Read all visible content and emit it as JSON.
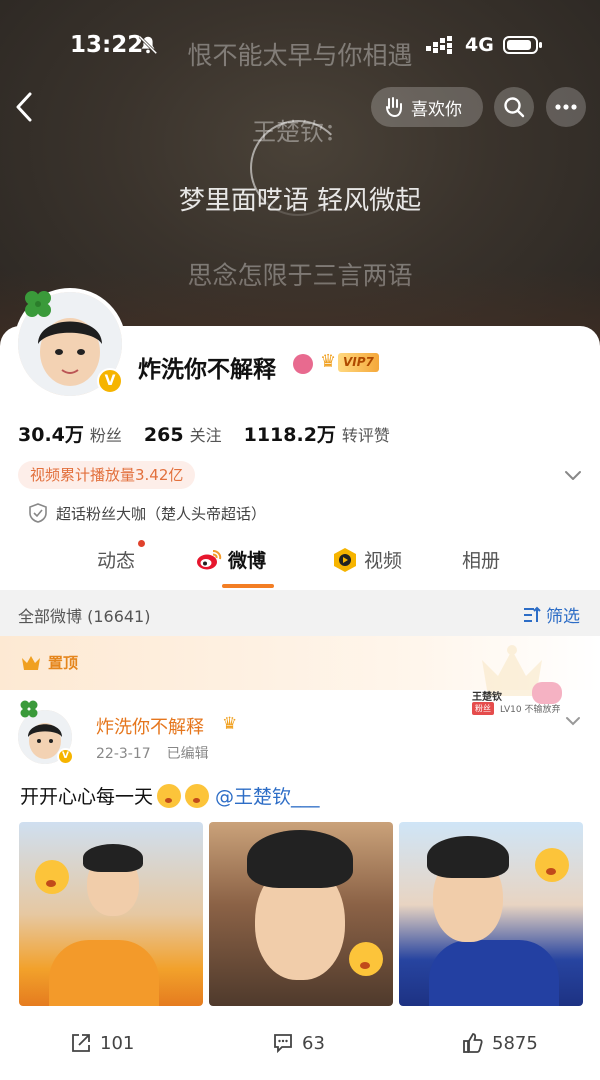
{
  "status_bar": {
    "time": "13:22",
    "network": "4G"
  },
  "header": {
    "lyrics": [
      "恨不能太早与你相遇",
      "王楚钦：",
      "梦里面呓语 轻风微起",
      "思念怎限于三言两语"
    ],
    "like_button_label": "喜欢你",
    "icons": [
      "back-arrow-icon",
      "heart-hand-icon",
      "search-icon",
      "more-icon"
    ]
  },
  "profile": {
    "name": "炸洗你不解释",
    "vip_level": "VIP7",
    "verified_badge": "V",
    "stats": [
      {
        "value": "30.4万",
        "label": "粉丝"
      },
      {
        "value": "265",
        "label": "关注"
      },
      {
        "value": "1118.2万",
        "label": "转评赞"
      }
    ],
    "video_plays_tag": "视频累计播放量3.42亿",
    "super_topic_line": "超话粉丝大咖（楚人头帝超话）"
  },
  "tabs": [
    {
      "label": "动态",
      "has_dot": true
    },
    {
      "label": "微博",
      "active": true
    },
    {
      "label": "视频"
    },
    {
      "label": "相册"
    }
  ],
  "feed": {
    "count_label": "全部微博 (16641)",
    "filter_label": "筛选"
  },
  "post": {
    "pinned_label": "置顶",
    "author": "炸洗你不解释",
    "date": "22-3-17",
    "edited": "已编辑",
    "text_prefix": "开开心心每一天",
    "mention": "@王楚钦___",
    "fan_card": {
      "name": "王楚钦",
      "level": "LV10",
      "note": "不输放弃",
      "tag": "粉丝"
    },
    "image_count": 3,
    "actions": {
      "repost": "101",
      "comment": "63",
      "like": "5875"
    }
  },
  "colors": {
    "accent_orange": "#f37e24",
    "link_blue": "#2d6dc6",
    "pinned_orange": "#e5861d",
    "verified_gold": "#f6b400"
  }
}
